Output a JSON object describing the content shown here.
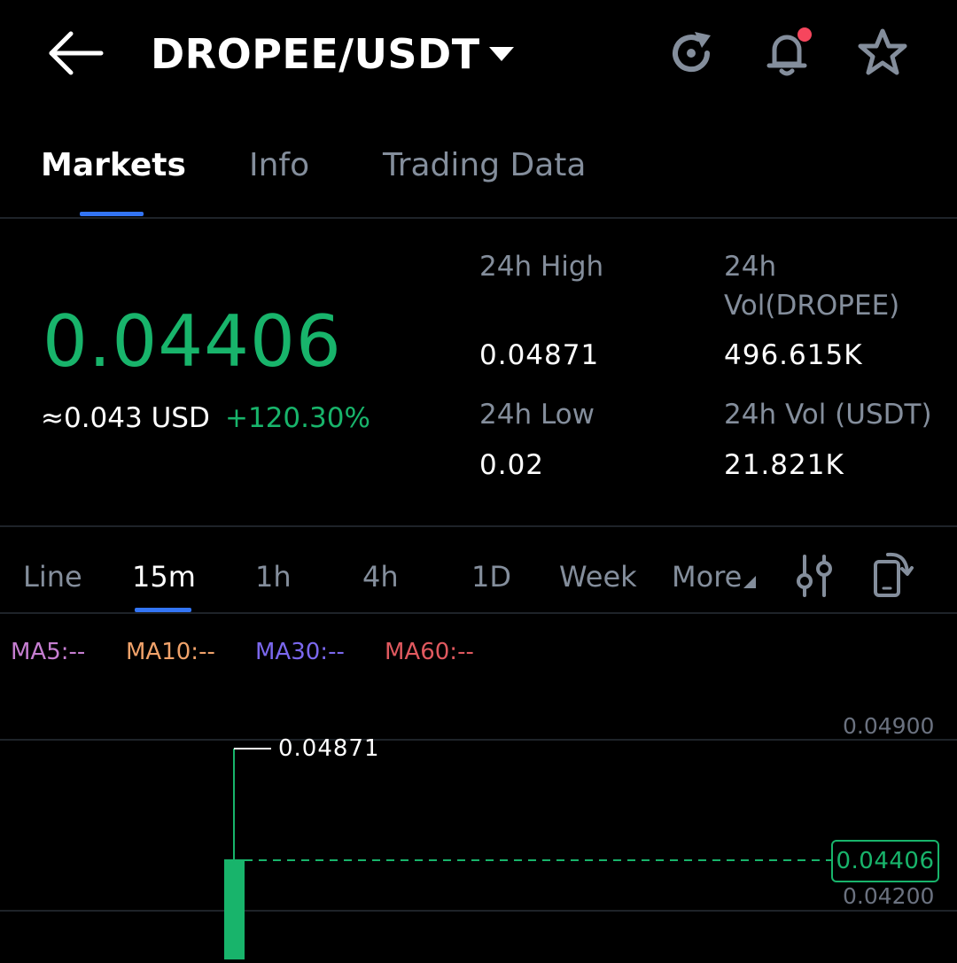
{
  "header": {
    "pair": "DROPEE/USDT"
  },
  "tabs": [
    {
      "label": "Markets",
      "active": true
    },
    {
      "label": "Info",
      "active": false
    },
    {
      "label": "Trading Data",
      "active": false
    }
  ],
  "ticker": {
    "price": "0.04406",
    "usd_value": "≈0.043 USD",
    "change": "+120.30%",
    "high_label": "24h High",
    "high_value": "0.04871",
    "low_label": "24h Low",
    "low_value": "0.02",
    "vol_base_label_1": "24h",
    "vol_base_label_2": "Vol(DROPEE)",
    "vol_base_value": "496.615K",
    "vol_quote_label": "24h Vol (USDT)",
    "vol_quote_value": "21.821K"
  },
  "timeframes": [
    {
      "label": "Line",
      "active": false
    },
    {
      "label": "15m",
      "active": true
    },
    {
      "label": "1h",
      "active": false
    },
    {
      "label": "4h",
      "active": false
    },
    {
      "label": "1D",
      "active": false
    },
    {
      "label": "Week",
      "active": false
    },
    {
      "label": "More",
      "active": false
    }
  ],
  "indicators": [
    {
      "label": "MA5:--",
      "color": "#c67ed1"
    },
    {
      "label": "MA10:--",
      "color": "#f0a26a"
    },
    {
      "label": "MA30:--",
      "color": "#7b68ee"
    },
    {
      "label": "MA60:--",
      "color": "#e0595f"
    }
  ],
  "chart": {
    "axis_top": "0.04900",
    "axis_bottom": "0.04200",
    "high_marker": "0.04871",
    "last_price": "0.04406"
  },
  "colors": {
    "up": "#18b46b",
    "accent": "#3375f6",
    "muted": "#848e9c",
    "notification": "#f6465d"
  }
}
